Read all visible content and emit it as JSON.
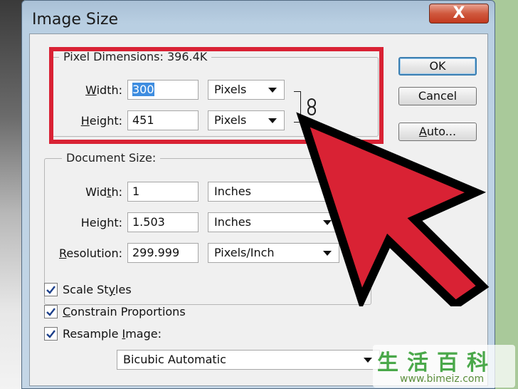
{
  "window": {
    "title": "Image Size",
    "close_glyph": "X"
  },
  "pixel_dimensions": {
    "legend": "Pixel Dimensions:  396.4K",
    "width_label_pre": "",
    "width_label_u": "W",
    "width_label_post": "idth:",
    "width_value": "300",
    "width_unit": "Pixels",
    "height_label_u": "H",
    "height_label_post": "eight:",
    "height_value": "451",
    "height_unit": "Pixels"
  },
  "document_size": {
    "legend": "Document Size:",
    "width_label_pre": "Wid",
    "width_label_u": "t",
    "width_label_post": "h:",
    "width_value": "1",
    "width_unit": "Inches",
    "height_label_pre": "Hei",
    "height_label_u": "g",
    "height_label_post": "ht:",
    "height_value": "1.503",
    "height_unit": "Inches",
    "resolution_label_u": "R",
    "resolution_label_post": "esolution:",
    "resolution_value": "299.999",
    "resolution_unit": "Pixels/Inch"
  },
  "buttons": {
    "ok": "OK",
    "cancel": "Cancel",
    "auto_pre": "",
    "auto_u": "A",
    "auto_post": "uto..."
  },
  "options": {
    "scale_styles_pre": "Scale St",
    "scale_styles_u": "y",
    "scale_styles_post": "les",
    "constrain_pre": "",
    "constrain_u": "C",
    "constrain_post": "onstrain Proportions",
    "resample_pre": "Resample ",
    "resample_u": "I",
    "resample_post": "mage:",
    "scale_styles_checked": true,
    "constrain_checked": true,
    "resample_checked": true,
    "resample_method": "Bicubic Automatic"
  },
  "colors": {
    "highlight_red": "#d92234",
    "selection_blue": "#3e8de0"
  },
  "watermark": {
    "chars": "生活百科",
    "url": "www.bimeiz.com"
  }
}
